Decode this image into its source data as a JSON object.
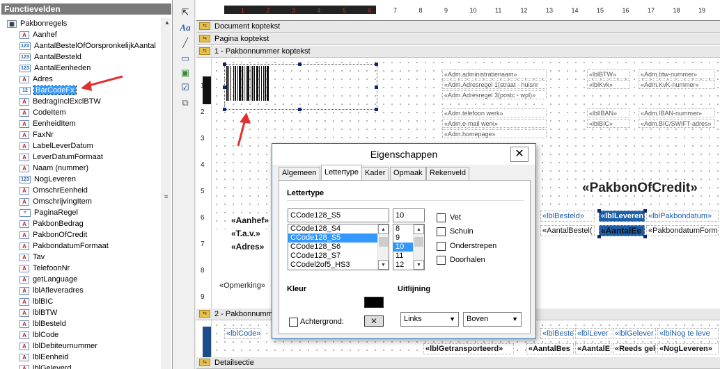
{
  "left_panel": {
    "title": "Functievelden",
    "root": "Pakbonregels",
    "items": [
      {
        "label": "Aanhef",
        "type": "A"
      },
      {
        "label": "AantalBestelOfOorspronkelijkAantal",
        "type": "123"
      },
      {
        "label": "AantalBesteld",
        "type": "123"
      },
      {
        "label": "AantalEenheden",
        "type": "123"
      },
      {
        "label": "Adres",
        "type": "A"
      },
      {
        "label": "BarCodeFx",
        "type": "12",
        "selected": true
      },
      {
        "label": "BedragInclExclBTW",
        "type": "A"
      },
      {
        "label": "CodeItem",
        "type": "A"
      },
      {
        "label": "EenheidItem",
        "type": "A"
      },
      {
        "label": "FaxNr",
        "type": "A"
      },
      {
        "label": "LabelLeverDatum",
        "type": "A"
      },
      {
        "label": "LeverDatumFormaat",
        "type": "A"
      },
      {
        "label": "Naam (nummer)",
        "type": "A"
      },
      {
        "label": "NogLeveren",
        "type": "123"
      },
      {
        "label": "OmschrEenheid",
        "type": "A"
      },
      {
        "label": "OmschrijvingItem",
        "type": "A"
      },
      {
        "label": "PaginaRegel",
        "type": "="
      },
      {
        "label": "PakbonBedrag",
        "type": "A"
      },
      {
        "label": "PakbonOfCredit",
        "type": "A"
      },
      {
        "label": "PakbondatumFormaat",
        "type": "A"
      },
      {
        "label": "Tav",
        "type": "A"
      },
      {
        "label": "TelefoonNr",
        "type": "A"
      },
      {
        "label": "getLanguage",
        "type": "A"
      },
      {
        "label": "lblAfleveradres",
        "type": "A"
      },
      {
        "label": "lblBIC",
        "type": "A"
      },
      {
        "label": "lblBTW",
        "type": "A"
      },
      {
        "label": "lblBesteld",
        "type": "A"
      },
      {
        "label": "lblCode",
        "type": "A"
      },
      {
        "label": "lblDebiteurnummer",
        "type": "A"
      },
      {
        "label": "lblEenheid",
        "type": "A"
      },
      {
        "label": "lblGeleverd",
        "type": "A"
      }
    ]
  },
  "toolbox": {
    "icons": [
      "pointer-icon",
      "text-icon",
      "line-icon",
      "rectangle-icon",
      "image-icon",
      "checkbox-icon",
      "subreport-icon"
    ]
  },
  "ruler": {
    "top": [
      "1",
      "2",
      "3",
      "4",
      "5",
      "6",
      "7",
      "8",
      "9",
      "10",
      "11",
      "12",
      "13",
      "14",
      "15",
      "16",
      "17",
      "18",
      "19"
    ],
    "left": [
      "1",
      "2",
      "3",
      "4",
      "5",
      "6",
      "7",
      "8",
      "9"
    ]
  },
  "bands": {
    "document_header": "Document koptekst",
    "page_header": "Pagina koptekst",
    "group_header": "1 - Pakbonnummer koptekst",
    "group_footer": "2 - Pakbonnumm",
    "detail": "Detailsectie"
  },
  "designer_fields": {
    "adm_name": "«Adm.administratienaam»",
    "adm_addr1": "«Adm.Adresregel 1(straat - huisnr",
    "adm_addr3": "«Adm.Adresregel 3(postc - wpl)»",
    "lbl_btw": "«lblBTW»",
    "lbl_kvk": "«lblKvk»",
    "adm_btw": "«Adm.btw-nummer»",
    "adm_kvk": "«Adm.KvK-nummer»",
    "adm_tel": "«Adm.telefoon werk»",
    "adm_mail": "«Adm.e-mail werk»",
    "adm_home": "«Adm.homepage»",
    "lbl_iban": "«lblIBAN»",
    "lbl_bic": "«lblBIC»",
    "adm_iban": "«Adm.IBAN-nummer»",
    "adm_bic": "«Adm.BIC/SWIFT-adres»",
    "big_title": "«PakbonOfCredit»",
    "aanhef": "«Aanhef»",
    "tav": "«T.a.v.»",
    "adres": "«Adres»",
    "lbl_besteld": "«lblBesteld»",
    "lbl_leveren": "«lblLeveren",
    "lbl_pakbondatum": "«lblPakbondatum»",
    "aantal_beste": "«AantalBestel(",
    "aantal_e": "«AantalEe",
    "pakbondatum_form": "«PakbondatumForm",
    "opmerking": "«Opmerking»",
    "lbl_code": "«lblCode»",
    "f_besteld": "«lblBesteld»",
    "f_lever": "«lblLever",
    "f_gelever": "«lblGelever",
    "f_nog": "«lblNog te leve",
    "getransporteerd": "«lblGetransporteerd»",
    "aantal_bes": "«AantalBes",
    "aantal_e2": "«AantalE",
    "reeds_gel": "«Reeds gel",
    "nog_leveren": "«NogLeveren»"
  },
  "dialog": {
    "title": "Eigenschappen",
    "close": "✕",
    "tabs": [
      "Algemeen",
      "Lettertype",
      "Kader",
      "Opmaak",
      "Rekenveld"
    ],
    "active_tab": "Lettertype",
    "section_font": "Lettertype",
    "font_value": "CCode128_S5",
    "size_value": "10",
    "font_list": [
      "CCode128_S4",
      "CCode128_S5",
      "CCode128_S6",
      "CCode128_S7",
      "CCodel2of5_HS3"
    ],
    "font_selected_index": 1,
    "size_list": [
      "8",
      "9",
      "10",
      "11",
      "12"
    ],
    "size_selected_index": 2,
    "styles": [
      "Vet",
      "Schuin",
      "Onderstrepen",
      "Doorhalen"
    ],
    "section_color": "Kleur",
    "background_label": "Achtergrond:",
    "section_align": "Uitlijning",
    "align_h": "Links",
    "align_v": "Boven",
    "fg_color": "#000000",
    "bg_color": "#ffffff"
  }
}
